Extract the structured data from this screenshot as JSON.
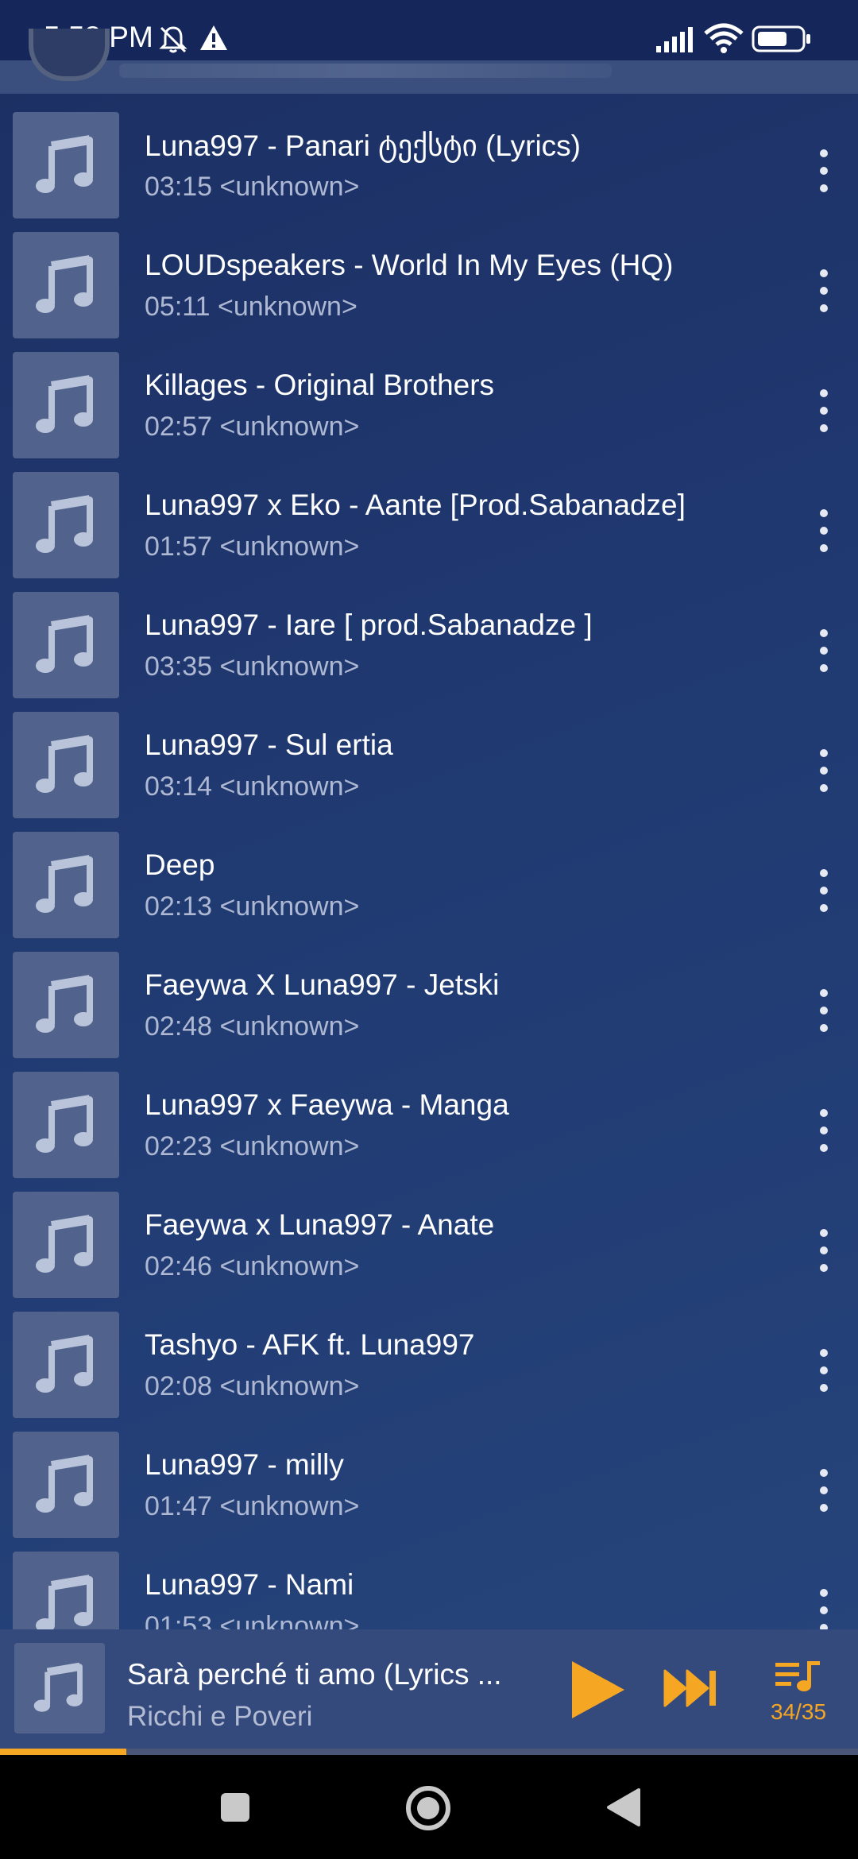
{
  "status_bar": {
    "time": "5:58 PM",
    "icons": [
      "mute-icon",
      "warning-icon",
      "signal-icon",
      "wifi-icon",
      "battery-icon"
    ]
  },
  "songs": [
    {
      "title": "Luna997 - Panari ტექსტი (Lyrics)",
      "duration": "03:15",
      "artist": "<unknown>"
    },
    {
      "title": "LOUDspeakers - World In My Eyes (HQ)",
      "duration": "05:11",
      "artist": "<unknown>"
    },
    {
      "title": "Killages - Original Brothers",
      "duration": "02:57",
      "artist": "<unknown>"
    },
    {
      "title": "Luna997 x Eko - Aante [Prod.Sabanadze]",
      "duration": "01:57",
      "artist": "<unknown>"
    },
    {
      "title": "Luna997 - Iare [ prod.Sabanadze ]",
      "duration": "03:35",
      "artist": "<unknown>"
    },
    {
      "title": "Luna997 - Sul ertia",
      "duration": "03:14",
      "artist": "<unknown>"
    },
    {
      "title": "Deep",
      "duration": "02:13",
      "artist": "<unknown>"
    },
    {
      "title": "Faeywa X Luna997 - Jetski",
      "duration": "02:48",
      "artist": "<unknown>"
    },
    {
      "title": "Luna997 x Faeywa - Manga",
      "duration": "02:23",
      "artist": "<unknown>"
    },
    {
      "title": "Faeywa x Luna997 - Anate",
      "duration": "02:46",
      "artist": "<unknown>"
    },
    {
      "title": "Tashyo - AFK ft. Luna997",
      "duration": "02:08",
      "artist": "<unknown>"
    },
    {
      "title": "Luna997 - milly",
      "duration": "01:47",
      "artist": "<unknown>"
    },
    {
      "title": "Luna997 - Nami",
      "duration": "01:53",
      "artist": "<unknown>"
    }
  ],
  "mini_player": {
    "title": "Sarà perché ti amo (Lyrics ...",
    "artist": "Ricchi e Poveri",
    "queue_position": "34/35",
    "progress_fraction": 0.147,
    "accent_color": "#f5a623"
  },
  "nav_bar": {
    "buttons": [
      "recents-button",
      "home-button",
      "back-button"
    ]
  }
}
